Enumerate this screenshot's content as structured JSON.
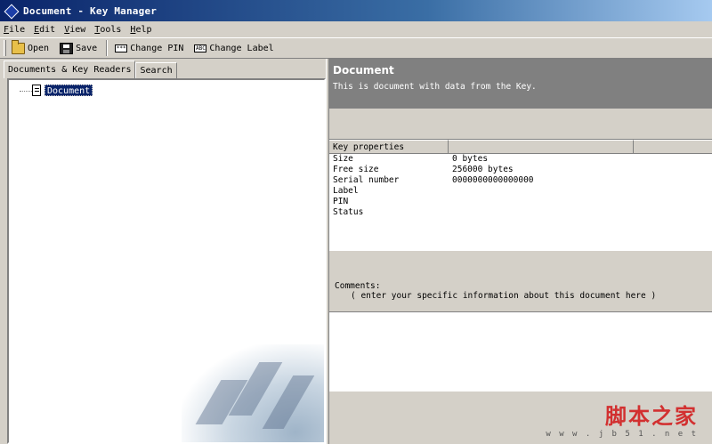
{
  "window": {
    "title": "Document - Key Manager"
  },
  "menu": {
    "items": [
      "File",
      "Edit",
      "View",
      "Tools",
      "Help"
    ]
  },
  "toolbar": {
    "open_label": "Open",
    "save_label": "Save",
    "change_pin_label": "Change PIN",
    "change_label_label": "Change Label"
  },
  "left": {
    "tabs": [
      "Documents & Key Readers",
      "Search"
    ],
    "tree": {
      "node": "Document"
    }
  },
  "document": {
    "title": "Document",
    "description": "This is document with data from the Key."
  },
  "properties": {
    "header": "Key properties",
    "rows": [
      {
        "key": "Size",
        "value": "0 bytes"
      },
      {
        "key": "Free size",
        "value": "256000 bytes"
      },
      {
        "key": "Serial number",
        "value": "0000000000000000"
      },
      {
        "key": "Label",
        "value": ""
      },
      {
        "key": "PIN",
        "value": ""
      },
      {
        "key": "Status",
        "value": ""
      }
    ]
  },
  "comments": {
    "label": "Comments:",
    "hint": "( enter your specific information about this document here )"
  },
  "watermark": {
    "cn": "脚本之家",
    "url": "w w w . j b 5 1 . n e t"
  }
}
